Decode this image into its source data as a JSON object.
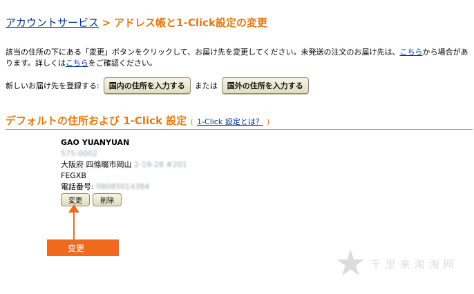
{
  "breadcrumb": {
    "root": "アカウントサービス",
    "separator": ">",
    "current": "アドレス帳と1-Click設定の変更"
  },
  "intro": {
    "text1": "該当の住所の下にある「変更」ボタンをクリックして、お届け先を変更してください。未発送の注文のお届け先は、",
    "link1": "こちら",
    "text2": "から場合があります。詳しくは",
    "link2": "こちら",
    "text3": "をご確認ください。"
  },
  "new_address": {
    "label": "新しいお届け先を登録する:",
    "domestic_button": "国内の住所を入力する",
    "or_text": "または",
    "foreign_button": "国外の住所を入力する"
  },
  "default_section": {
    "title": "デフォルトの住所および 1-Click 設定",
    "paren_open": "(",
    "link": "1-Click 設定とは？",
    "paren_close": ")"
  },
  "address": {
    "name": "GAO YUANYUAN",
    "postal": "575-0002",
    "line1": "大阪府 四條畷市岡山",
    "line1_blur": "2-19-28 #201",
    "line2": "FEGXB",
    "phone_label": "電話番号:",
    "phone_value": "08085014384",
    "edit_button": "変更",
    "delete_button": "削除"
  },
  "annotation": {
    "callout_label": "变更",
    "color": "#f06a1c"
  },
  "watermark": {
    "text": "千里来淘淘网"
  },
  "colors": {
    "link": "#003399",
    "accent": "#e47911"
  }
}
